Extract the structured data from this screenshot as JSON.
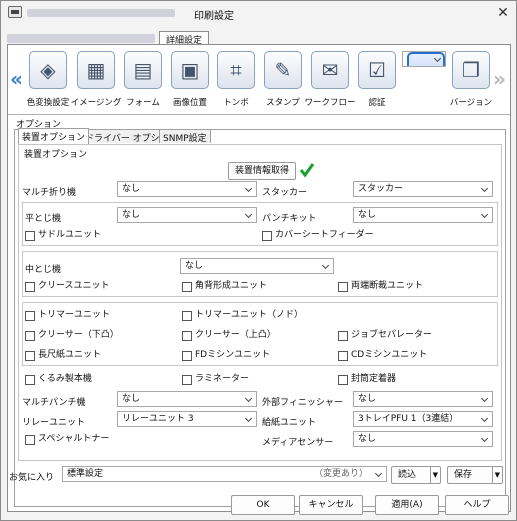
{
  "titlebar": {
    "title": "印刷設定",
    "close": "✕"
  },
  "tabs": {
    "detail": "詳細設定"
  },
  "iconbar": {
    "items": [
      {
        "label": "色変換設定",
        "icon": "color-conversion-icon"
      },
      {
        "label": "イメージング",
        "icon": "imaging-icon"
      },
      {
        "label": "フォーム",
        "icon": "form-icon"
      },
      {
        "label": "画像位置",
        "icon": "image-position-icon"
      },
      {
        "label": "トンボ",
        "icon": "crop-marks-icon"
      },
      {
        "label": "スタンプ",
        "icon": "stamp-icon"
      },
      {
        "label": "ワークフロー",
        "icon": "workflow-icon"
      },
      {
        "label": "認証",
        "icon": "authentication-icon"
      },
      {
        "label": "オプション",
        "icon": "option-icon",
        "selected": true
      },
      {
        "label": "バージョン",
        "icon": "version-icon"
      }
    ]
  },
  "options_label": "オプション",
  "subtabs": [
    "装置オプション",
    "ドライバー オプション",
    "SNMP設定"
  ],
  "device": {
    "group_label": "装置オプション",
    "fetch_button": "装置情報取得",
    "multifold_label": "マルチ折り機",
    "multifold_value": "なし",
    "stacker_label": "スタッカー",
    "stacker_value": "スタッカー",
    "flatstitch_label": "平とじ機",
    "flatstitch_value": "なし",
    "punchkit_label": "パンチキット",
    "punchkit_value": "なし",
    "saddle_unit": "サドルユニット",
    "cover_feeder": "カバーシートフィーダー",
    "midstitch_label": "中とじ機",
    "midstitch_value": "なし",
    "crease_unit": "クリースユニット",
    "square_back": "角背形成ユニット",
    "two_side_trim": "両端断裁ユニット",
    "trimmer_unit": "トリマーユニット",
    "trimmer_unit_n": "トリマーユニット（ノド）",
    "creaser_down": "クリーサー（下凸）",
    "creaser_up": "クリーサー（上凸）",
    "job_separator": "ジョブセパレーター",
    "long_paper": "長尺紙ユニット",
    "fd_perf": "FDミシンユニット",
    "cd_perf": "CDミシンユニット",
    "binder": "くるみ製本機",
    "laminator": "ラミネーター",
    "envelope_sealer": "封筒定着器",
    "multipunch_label": "マルチパンチ機",
    "multipunch_value": "なし",
    "ext_finisher_label": "外部フィニッシャー",
    "ext_finisher_value": "なし",
    "relay_label": "リレーユニット",
    "relay_value": "リレーユニット 3",
    "feeder_label": "給紙ユニット",
    "feeder_value": "3トレイPFU 1（3連結）",
    "special_toner": "スペシャルトナー",
    "media_sensor_label": "メディアセンサー",
    "media_sensor_value": "なし"
  },
  "footer": {
    "favorite_label": "お気に入り",
    "favorite_value": "標準設定",
    "changed": "（変更あり）",
    "load": "読込",
    "save": "保存"
  },
  "buttons": {
    "ok": "OK",
    "cancel": "キャンセル",
    "apply": "適用(A)",
    "help": "ヘルプ"
  }
}
